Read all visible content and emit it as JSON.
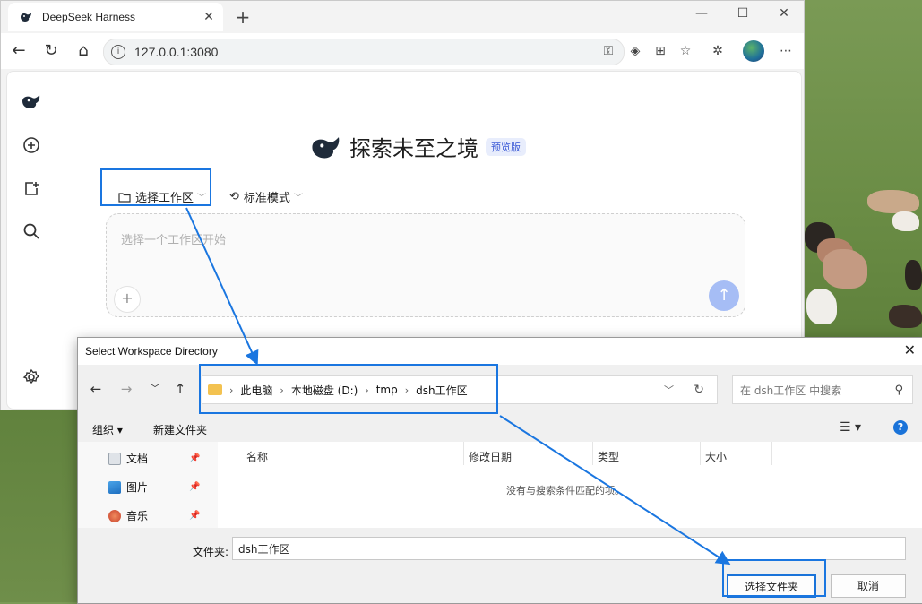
{
  "browser": {
    "tab_title": "DeepSeek Harness",
    "url": "127.0.0.1:3080"
  },
  "app": {
    "headline": "探索未至之境",
    "badge": "预览版",
    "workspace_picker": "选择工作区",
    "mode_picker": "标准模式",
    "chat_placeholder": "选择一个工作区开始"
  },
  "dialog": {
    "title": "Select Workspace Directory",
    "breadcrumb": [
      "此电脑",
      "本地磁盘 (D:)",
      "tmp",
      "dsh工作区"
    ],
    "search_placeholder": "在 dsh工作区 中搜索",
    "organize": "组织 ▾",
    "new_folder": "新建文件夹",
    "nav_items": [
      {
        "label": "文档",
        "icon": "document-icon"
      },
      {
        "label": "图片",
        "icon": "pictures-icon"
      },
      {
        "label": "音乐",
        "icon": "music-icon"
      }
    ],
    "columns": [
      "名称",
      "修改日期",
      "类型",
      "大小"
    ],
    "empty_message": "没有与搜索条件匹配的项。",
    "folder_label": "文件夹:",
    "folder_value": "dsh工作区",
    "select_button": "选择文件夹",
    "cancel_button": "取消"
  },
  "colors": {
    "highlight": "#1a76e0",
    "send_button": "#a6bdf5",
    "badge_text": "#3d5bd6"
  }
}
